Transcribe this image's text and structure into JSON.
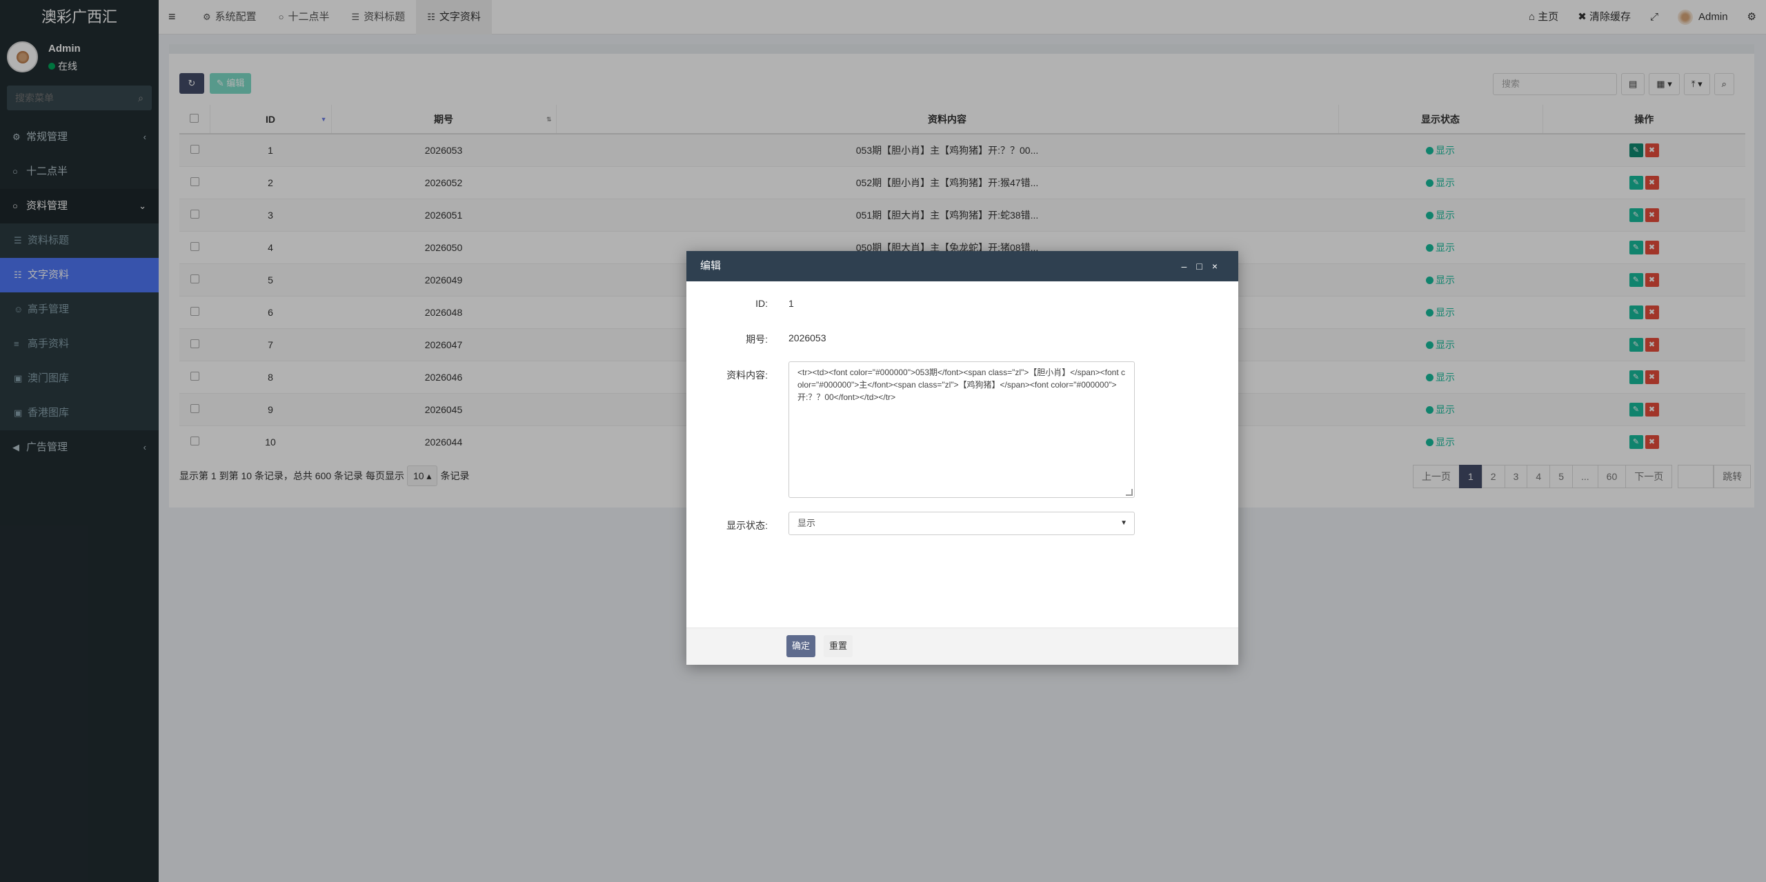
{
  "app": {
    "title": "澳彩广西汇"
  },
  "user": {
    "name": "Admin",
    "status": "在线"
  },
  "sidebar": {
    "search_placeholder": "搜索菜单",
    "items": [
      {
        "label": "常规管理",
        "icon": "cogs-icon"
      },
      {
        "label": "十二点半",
        "icon": "circle-icon"
      },
      {
        "label": "资料管理",
        "icon": "circle-icon"
      },
      {
        "label": "资料标题",
        "icon": "list-icon"
      },
      {
        "label": "文字资料",
        "icon": "file-icon"
      },
      {
        "label": "高手管理",
        "icon": "user-icon"
      },
      {
        "label": "高手资料",
        "icon": "database-icon"
      },
      {
        "label": "澳门图库",
        "icon": "image-icon"
      },
      {
        "label": "香港图库",
        "icon": "image-icon"
      },
      {
        "label": "广告管理",
        "icon": "bullhorn-icon"
      }
    ]
  },
  "topbar": {
    "tabs": [
      {
        "label": "系统配置",
        "icon": "gear-icon"
      },
      {
        "label": "十二点半",
        "icon": "circle-icon"
      },
      {
        "label": "资料标题",
        "icon": "list-icon"
      },
      {
        "label": "文字资料",
        "icon": "file-icon"
      }
    ],
    "home": "主页",
    "clear_cache": "清除缓存",
    "admin": "Admin"
  },
  "toolbar": {
    "edit_label": "编辑",
    "search_placeholder": "搜索"
  },
  "table": {
    "headers": [
      "ID",
      "期号",
      "资料内容",
      "显示状态",
      "操作"
    ],
    "rows": [
      {
        "id": "1",
        "issue": "2026053",
        "content": "053期【胆小肖】主【鸡狗猪】开:？？00...",
        "status": "显示"
      },
      {
        "id": "2",
        "issue": "2026052",
        "content": "052期【胆小肖】主【鸡狗猪】开:猴47错...",
        "status": "显示"
      },
      {
        "id": "3",
        "issue": "2026051",
        "content": "051期【胆大肖】主【鸡狗猪】开:蛇38错...",
        "status": "显示"
      },
      {
        "id": "4",
        "issue": "2026050",
        "content": "050期【胆大肖】主【兔龙蛇】开:猪08错...",
        "status": "显示"
      },
      {
        "id": "5",
        "issue": "2026049",
        "content": "",
        "status": "显示"
      },
      {
        "id": "6",
        "issue": "2026048",
        "content": "",
        "status": "显示"
      },
      {
        "id": "7",
        "issue": "2026047",
        "content": "",
        "status": "显示"
      },
      {
        "id": "8",
        "issue": "2026046",
        "content": "",
        "status": "显示"
      },
      {
        "id": "9",
        "issue": "2026045",
        "content": "",
        "status": "显示"
      },
      {
        "id": "10",
        "issue": "2026044",
        "content": "",
        "status": "显示"
      }
    ]
  },
  "pager": {
    "info_prefix": "显示第 1 到第 10 条记录，总共 600 条记录 每页显示",
    "per_page": "10",
    "info_suffix": "条记录",
    "prev": "上一页",
    "pages": [
      "1",
      "2",
      "3",
      "4",
      "5",
      "...",
      "60"
    ],
    "next": "下一页",
    "jump": "跳转"
  },
  "modal": {
    "title": "编辑",
    "id_label": "ID:",
    "id_value": "1",
    "issue_label": "期号:",
    "issue_value": "2026053",
    "content_label": "资料内容:",
    "content_value": "<tr><td><font color=\"#000000\">053期</font><span class=\"zl\">【胆小肖】</span><font color=\"#000000\">主</font><span class=\"zl\">【鸡狗猪】</span><font color=\"#000000\">开:？？00</font></td></tr>",
    "status_label": "显示状态:",
    "status_value": "显示",
    "ok": "确定",
    "reset": "重置"
  },
  "colors": {
    "accent": "#4f77f6",
    "sidebar": "#222d32",
    "success": "#18bc9c",
    "danger": "#e74c3c",
    "modal_header": "#2f4050"
  }
}
